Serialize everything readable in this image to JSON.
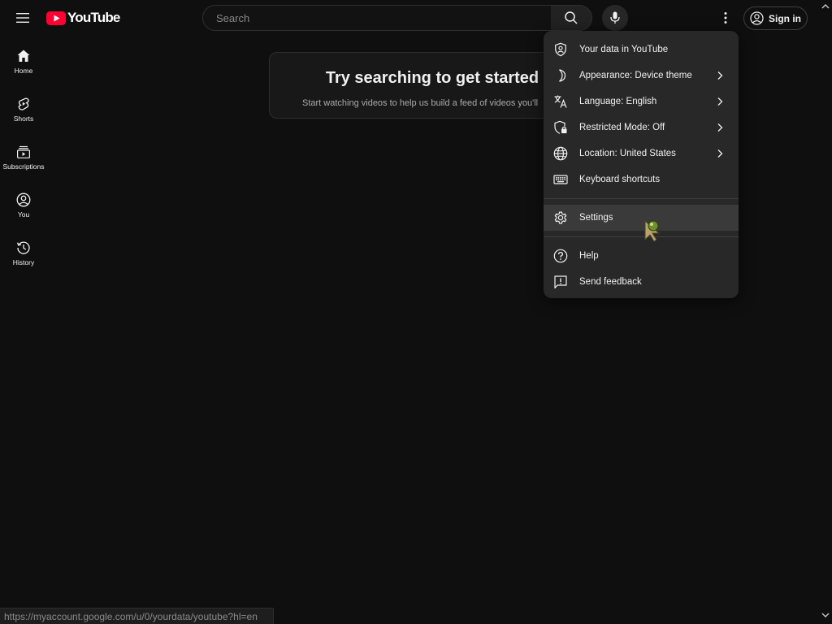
{
  "header": {
    "logo_text": "YouTube",
    "search_placeholder": "Search",
    "sign_in_label": "Sign in"
  },
  "sidebar": {
    "items": [
      {
        "label": "Home",
        "icon": "home-icon"
      },
      {
        "label": "Shorts",
        "icon": "shorts-icon"
      },
      {
        "label": "Subscriptions",
        "icon": "subscriptions-icon"
      },
      {
        "label": "You",
        "icon": "you-icon"
      },
      {
        "label": "History",
        "icon": "history-icon"
      }
    ]
  },
  "main": {
    "prompt_title": "Try searching to get started",
    "prompt_subtitle": "Start watching videos to help us build a feed of videos you'll"
  },
  "menu": {
    "items": [
      {
        "label": "Your data in YouTube",
        "icon": "shield-user-icon",
        "chevron": false
      },
      {
        "label": "Appearance: Device theme",
        "icon": "moon-icon",
        "chevron": true
      },
      {
        "label": "Language: English",
        "icon": "translate-icon",
        "chevron": true
      },
      {
        "label": "Restricted Mode: Off",
        "icon": "restricted-shield-icon",
        "chevron": true
      },
      {
        "label": "Location: United States",
        "icon": "globe-icon",
        "chevron": true
      },
      {
        "label": "Keyboard shortcuts",
        "icon": "keyboard-icon",
        "chevron": false
      },
      {
        "label": "Settings",
        "icon": "gear-icon",
        "chevron": false,
        "hovered": true
      },
      {
        "label": "Help",
        "icon": "help-icon",
        "chevron": false
      },
      {
        "label": "Send feedback",
        "icon": "feedback-icon",
        "chevron": false
      }
    ]
  },
  "status_bar": {
    "url": "https://myaccount.google.com/u/0/yourdata/youtube?hl=en"
  },
  "colors": {
    "background": "#0f0f0f",
    "menu_background": "#282828",
    "brand_red": "#ff0033",
    "text": "#f1f1f1"
  }
}
